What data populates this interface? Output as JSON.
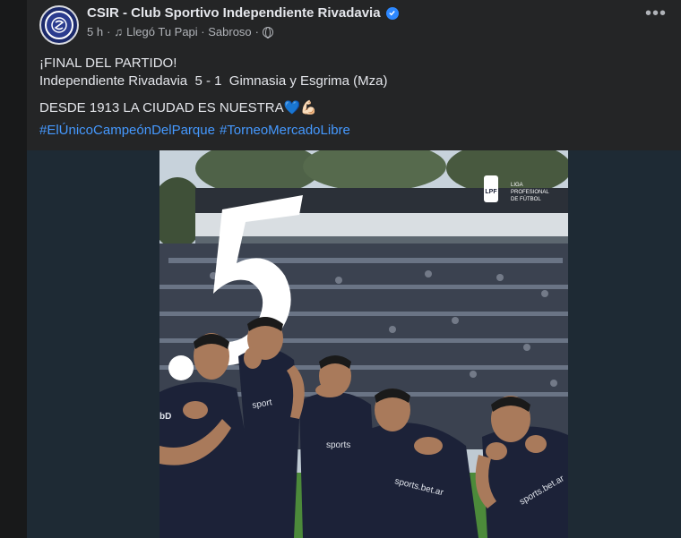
{
  "post": {
    "page_name": "CSIR - Club Sportivo Independiente Rivadavia",
    "verified": true,
    "time": "5 h",
    "music": "Llegó Tu Papi · Sabroso",
    "privacy_icon": "globe-icon",
    "lines": [
      "¡FINAL DEL PARTIDO!",
      "Independiente Rivadavia  5 - 1  Gimnasia y Esgrima (Mza)",
      "DESDE 1913 LA CIUDAD ES NUESTRA"
    ],
    "emoji": [
      "💙",
      "💪🏻"
    ],
    "hashtags": [
      "#ElÚnicoCampeónDelParque",
      "#TorneoMercadoLibre"
    ]
  },
  "image": {
    "big_number": "5",
    "league_badge": "LPF",
    "league_text": "LIGA PROFESIONAL DE FÚTBOL",
    "sponsor": "sports.bet.ar"
  },
  "colors": {
    "post_bg": "#242526",
    "hashtag": "#4599ff",
    "jersey": "#1c2238"
  }
}
